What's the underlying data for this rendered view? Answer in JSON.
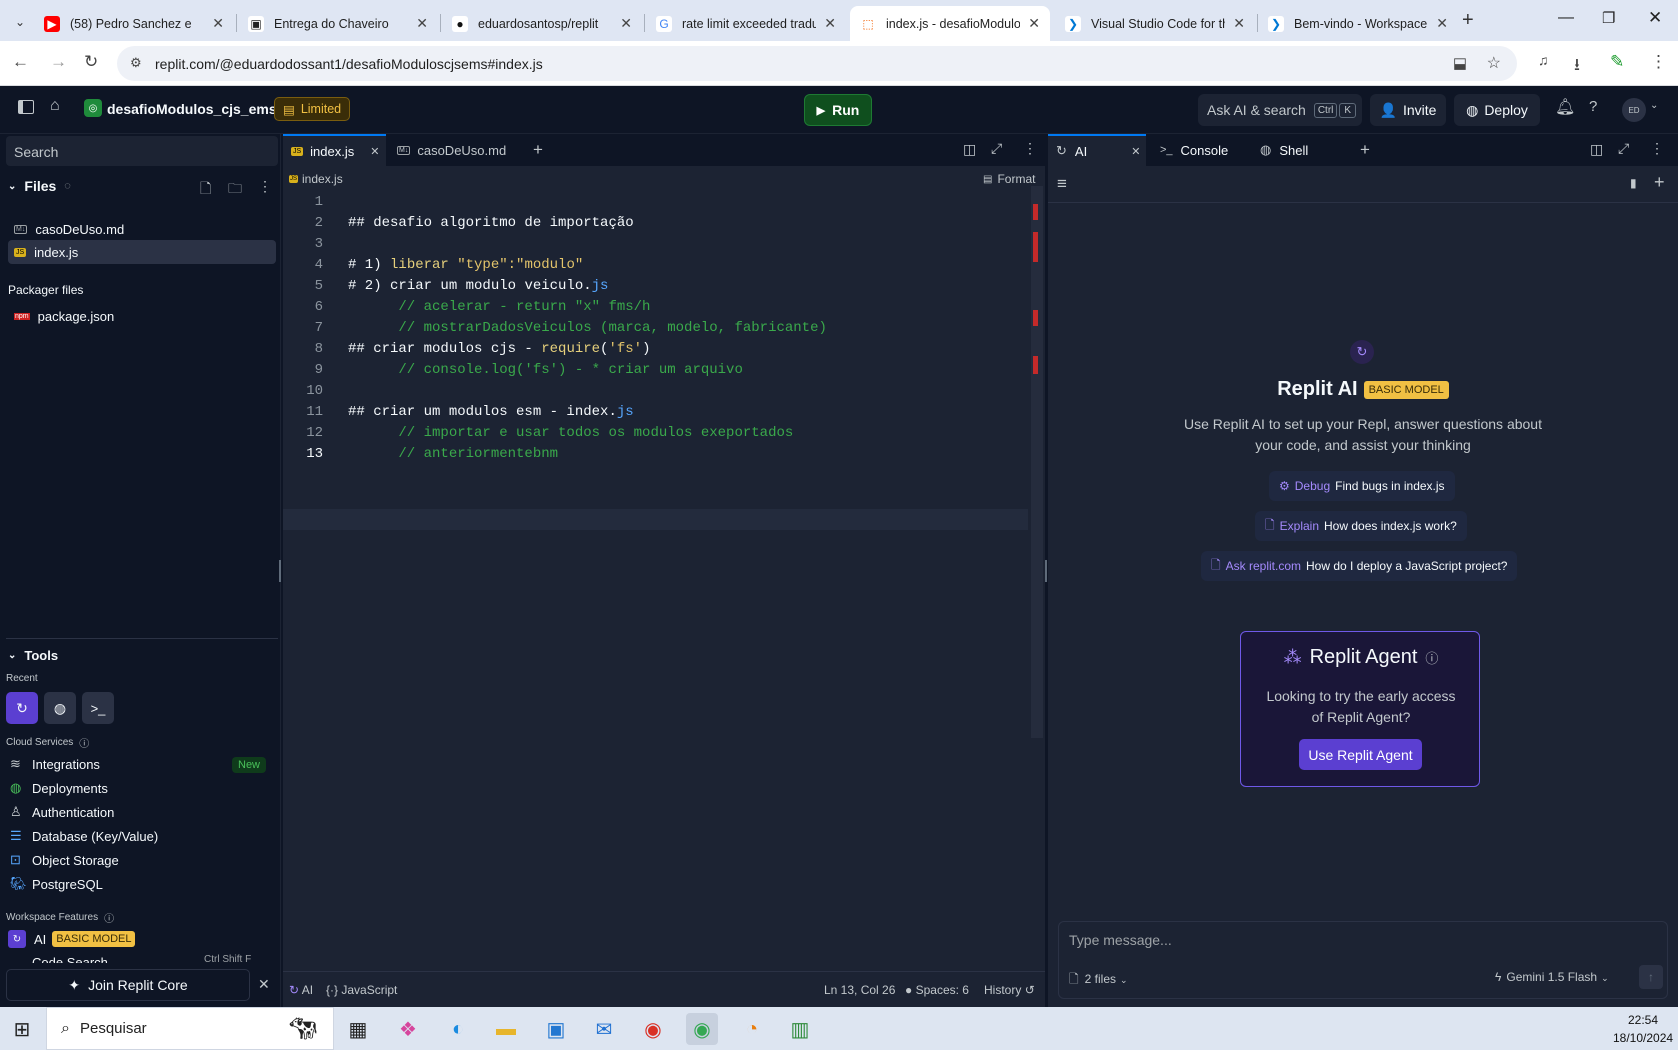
{
  "browser": {
    "tabs": [
      {
        "title": "(58) Pedro Sanchez e",
        "fav": "▶",
        "favbg": "#ff0000",
        "favcolor": "#fff"
      },
      {
        "title": "Entrega do Chaveiro",
        "fav": "▣",
        "favbg": "#fff",
        "favcolor": "#222"
      },
      {
        "title": "eduardosantosp/replit",
        "fav": "●",
        "favbg": "#fff",
        "favcolor": "#111"
      },
      {
        "title": "rate limit exceeded tradu",
        "fav": "G",
        "favbg": "#fff",
        "favcolor": "#4285f4"
      },
      {
        "title": "index.js - desafioModulo",
        "fav": "⬚",
        "favbg": "#fff",
        "favcolor": "#f26207"
      },
      {
        "title": "Visual Studio Code for th",
        "fav": "❯",
        "favbg": "#fff",
        "favcolor": "#0078d4"
      },
      {
        "title": "Bem-vindo - Workspace",
        "fav": "❯",
        "favbg": "#fff",
        "favcolor": "#0078d4"
      }
    ],
    "url": "replit.com/@eduardodossant1/desafioModulos​cjsems#index.js"
  },
  "header": {
    "repl_name": "desafioModulos_cjs_ems",
    "limited": "Limited",
    "run": "Run",
    "search_placeholder": "Ask AI & search",
    "kbd1": "Ctrl",
    "kbd2": "K",
    "invite": "Invite",
    "deploy": "Deploy",
    "avatar": "ED"
  },
  "sidebar": {
    "search": "Search",
    "files_title": "Files",
    "files": [
      {
        "name": "casoDeUso.md",
        "icon": "M↓"
      },
      {
        "name": "index.js",
        "icon": "JS"
      }
    ],
    "packager_title": "Packager files",
    "packager": [
      {
        "name": "package.json",
        "icon": "npm"
      }
    ],
    "tools_title": "Tools",
    "recent": "Recent",
    "cloud_title": "Cloud Services",
    "cloud": [
      "Integrations",
      "Deployments",
      "Authentication",
      "Database (Key/Value)",
      "Object Storage",
      "PostgreSQL"
    ],
    "new_badge": "New",
    "workspace_title": "Workspace Features",
    "ai": "AI",
    "basic_model": "BASIC MODEL",
    "code_search": "Code Search",
    "code_search_kbd": "Ctrl Shift F",
    "join": "Join Replit Core"
  },
  "editor": {
    "tabs": [
      "index.js",
      "casoDeUso.md"
    ],
    "breadcrumb": "index.js",
    "format": "Format",
    "lines": [
      "1",
      "2",
      "3",
      "4",
      "5",
      "6",
      "7",
      "8",
      "9",
      "10",
      "11",
      "12",
      "13"
    ],
    "status": {
      "ai": "AI",
      "lang": "JavaScript",
      "pos": "Ln 13, Col 26",
      "spaces": "Spaces: 6",
      "history": "History"
    }
  },
  "code": {
    "l2": "## desafio algoritmo de importação",
    "l4a": "# 1) ",
    "l4b": "liberar",
    "l4c": " \"type\":\"modulo\"",
    "l5a": "# 2) ",
    "l5b": "criar um modulo veiculo.",
    "l5c": "js",
    "l6": "      // acelerar - return \"x\" fms/h",
    "l7": "      // mostrarDadosVeiculos (marca, modelo, fabricante)",
    "l8a": "## criar modulos cjs - ",
    "l8b": "require",
    "l8c": "(",
    "l8d": "'fs'",
    "l8e": ")",
    "l9": "      // console.log('fs') - * criar um arquivo",
    "l11a": "## criar um modulos esm - index.",
    "l11b": "js",
    "l12": "      // importar e usar todos os modulos exeportados",
    "l13": "      // anteriormentebnm"
  },
  "ai_pane": {
    "tabs": [
      "AI",
      "Console",
      "Shell"
    ],
    "title": "Replit AI",
    "badge": "BASIC MODEL",
    "desc": "Use Replit AI to set up your Repl, answer questions about your code, and assist your thinking",
    "chips": [
      {
        "prefix": "Debug",
        "text": "Find bugs in index.js"
      },
      {
        "prefix": "Explain",
        "text": "How does index.js work?"
      },
      {
        "prefix": "Ask replit.com",
        "text": "How do I deploy a JavaScript project?"
      }
    ],
    "agent_title": "Replit Agent",
    "agent_desc": "Looking to try the early access of Replit Agent?",
    "agent_btn": "Use Replit Agent",
    "message_placeholder": "Type message...",
    "files_chip": "2 files",
    "model": "Gemini 1.5 Flash"
  },
  "taskbar": {
    "search": "Pesquisar",
    "time": "22:54",
    "date": "18/10/2024"
  }
}
